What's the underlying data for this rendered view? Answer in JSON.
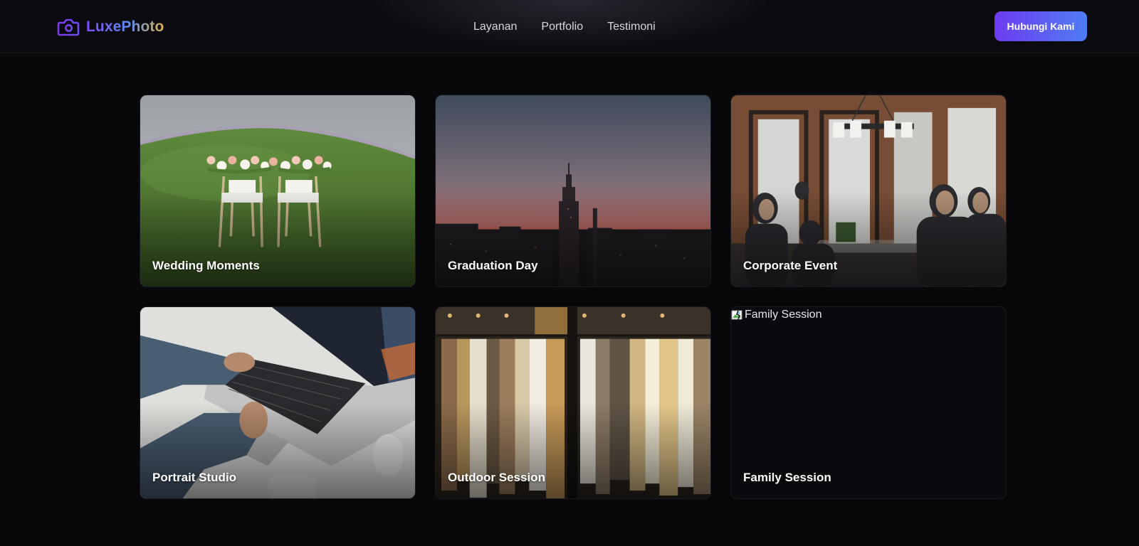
{
  "brand": {
    "name": "LuxePhoto",
    "icon": "camera-icon"
  },
  "nav": {
    "links": [
      {
        "label": "Layanan"
      },
      {
        "label": "Portfolio"
      },
      {
        "label": "Testimoni"
      }
    ],
    "cta_label": "Hubungi Kami"
  },
  "colors": {
    "background": "#08080b",
    "accent_start": "#6d3cf0",
    "accent_end": "#4f7cf3",
    "logo_gold": "#e0b64b"
  },
  "gallery": {
    "items": [
      {
        "title": "Wedding Moments",
        "image": "wedding-chairs-photo"
      },
      {
        "title": "Graduation Day",
        "image": "city-skyline-photo"
      },
      {
        "title": "Corporate Event",
        "image": "office-meeting-photo"
      },
      {
        "title": "Portrait Studio",
        "image": "laptop-typing-photo"
      },
      {
        "title": "Outdoor Session",
        "image": "clothing-rack-photo"
      },
      {
        "title": "Family Session",
        "image": "broken-image",
        "alt": "Family Session"
      }
    ]
  }
}
